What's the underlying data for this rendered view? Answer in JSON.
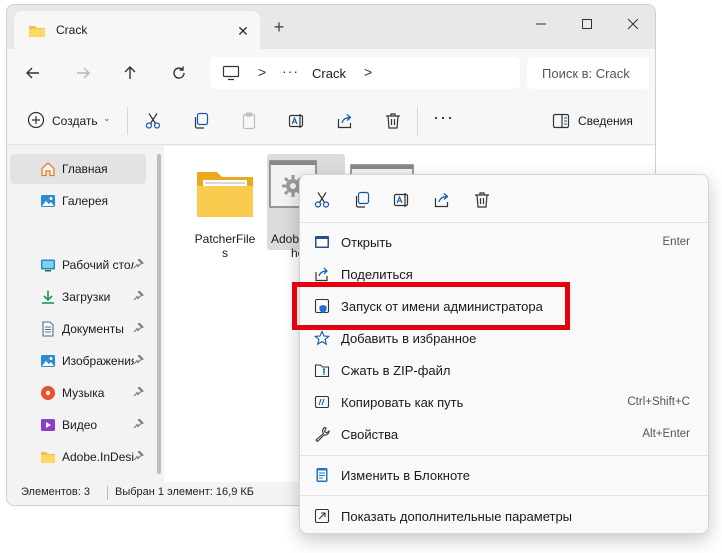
{
  "window": {
    "tab_title": "Crack",
    "new_tab_label": "+",
    "tab_close_label": "✕"
  },
  "navigation": {
    "separator": ">",
    "overflow_label": "···",
    "breadcrumb": "Crack",
    "search_placeholder": "Поиск в: Crack"
  },
  "toolbar": {
    "create_label": "Создать",
    "create_caret": "⌄",
    "more_label": "···",
    "details_label": "Сведения"
  },
  "sidebar": {
    "items": [
      {
        "label": "Главная",
        "icon": "home-icon",
        "pinned": false
      },
      {
        "label": "Галерея",
        "icon": "gallery-icon",
        "pinned": false
      },
      {
        "label": "Рабочий стол",
        "icon": "desktop-icon",
        "pinned": true
      },
      {
        "label": "Загрузки",
        "icon": "downloads-icon",
        "pinned": true
      },
      {
        "label": "Документы",
        "icon": "documents-icon",
        "pinned": true
      },
      {
        "label": "Изображения",
        "icon": "pictures-icon",
        "pinned": true
      },
      {
        "label": "Музыка",
        "icon": "music-icon",
        "pinned": true
      },
      {
        "label": "Видео",
        "icon": "videos-icon",
        "pinned": true
      },
      {
        "label": "Adobe.InDesign",
        "icon": "folder-icon",
        "pinned": true
      }
    ]
  },
  "files": [
    {
      "name_line1": "PatcherFile",
      "name_line2": "s",
      "type": "folder"
    },
    {
      "name_line1": "Adob",
      "name_line2": "he",
      "type": "executable"
    },
    {
      "name_line1": "",
      "name_line2": "",
      "type": "file"
    }
  ],
  "status": {
    "count": "Элементов: 3",
    "selection": "Выбран 1 элемент: 16,9 КБ"
  },
  "context_menu": {
    "items": [
      {
        "label": "Открыть",
        "shortcut": "Enter",
        "icon": "open-icon"
      },
      {
        "label": "Поделиться",
        "shortcut": "",
        "icon": "share-icon"
      },
      {
        "label": "Запуск от имени администратора",
        "shortcut": "",
        "icon": "shield-icon"
      },
      {
        "label": "Добавить в избранное",
        "shortcut": "",
        "icon": "star-icon"
      },
      {
        "label": "Сжать в ZIP-файл",
        "shortcut": "",
        "icon": "zip-icon"
      },
      {
        "label": "Копировать как путь",
        "shortcut": "Ctrl+Shift+C",
        "icon": "copy-path-icon"
      },
      {
        "label": "Свойства",
        "shortcut": "Alt+Enter",
        "icon": "wrench-icon"
      },
      {
        "label": "Изменить в Блокноте",
        "shortcut": "",
        "icon": "notepad-icon"
      },
      {
        "label": "Показать дополнительные параметры",
        "shortcut": "",
        "icon": "more-options-icon"
      }
    ]
  },
  "colors": {
    "highlight": "#e3000f",
    "accent": "#0067c0",
    "folder": "#f5c242"
  }
}
